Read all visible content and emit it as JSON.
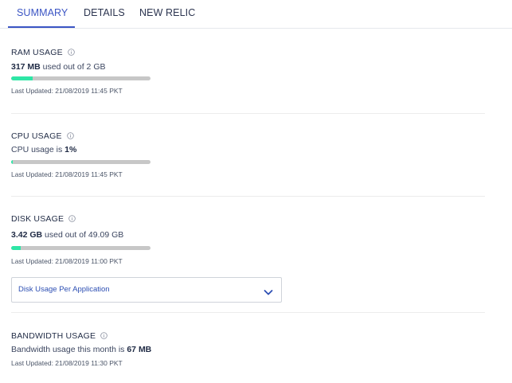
{
  "tabs": [
    {
      "label": "SUMMARY",
      "active": true
    },
    {
      "label": "DETAILS",
      "active": false
    },
    {
      "label": "NEW RELIC",
      "active": false
    }
  ],
  "ram": {
    "title": "RAM USAGE",
    "value": "317 MB",
    "suffix": " used out of 2 GB",
    "usage_fraction": 0.155,
    "updated": "Last Updated: 21/08/2019 11:45 PKT"
  },
  "cpu": {
    "title": "CPU USAGE",
    "prefix": "CPU usage is ",
    "value": "1%",
    "usage_fraction": 0.01,
    "updated": "Last Updated: 21/08/2019 11:45 PKT"
  },
  "disk": {
    "title": "DISK USAGE",
    "value": "3.42 GB",
    "suffix": " used out of 49.09 GB",
    "usage_fraction": 0.07,
    "updated": "Last Updated: 21/08/2019 11:00 PKT",
    "dropdown_label": "Disk Usage Per Application"
  },
  "bandwidth": {
    "title": "BANDWIDTH USAGE",
    "prefix": "Bandwidth usage this month is ",
    "value": "67 MB",
    "updated": "Last Updated: 21/08/2019 11:30 PKT"
  },
  "colors": {
    "accent": "#3b55c4",
    "bar_fill": "#2ee6a6",
    "bar_track": "#c7c7c7",
    "link": "#2d4fb3"
  },
  "icons": {
    "info": "info-circle-icon",
    "dropdown": "chevron-down-icon"
  }
}
